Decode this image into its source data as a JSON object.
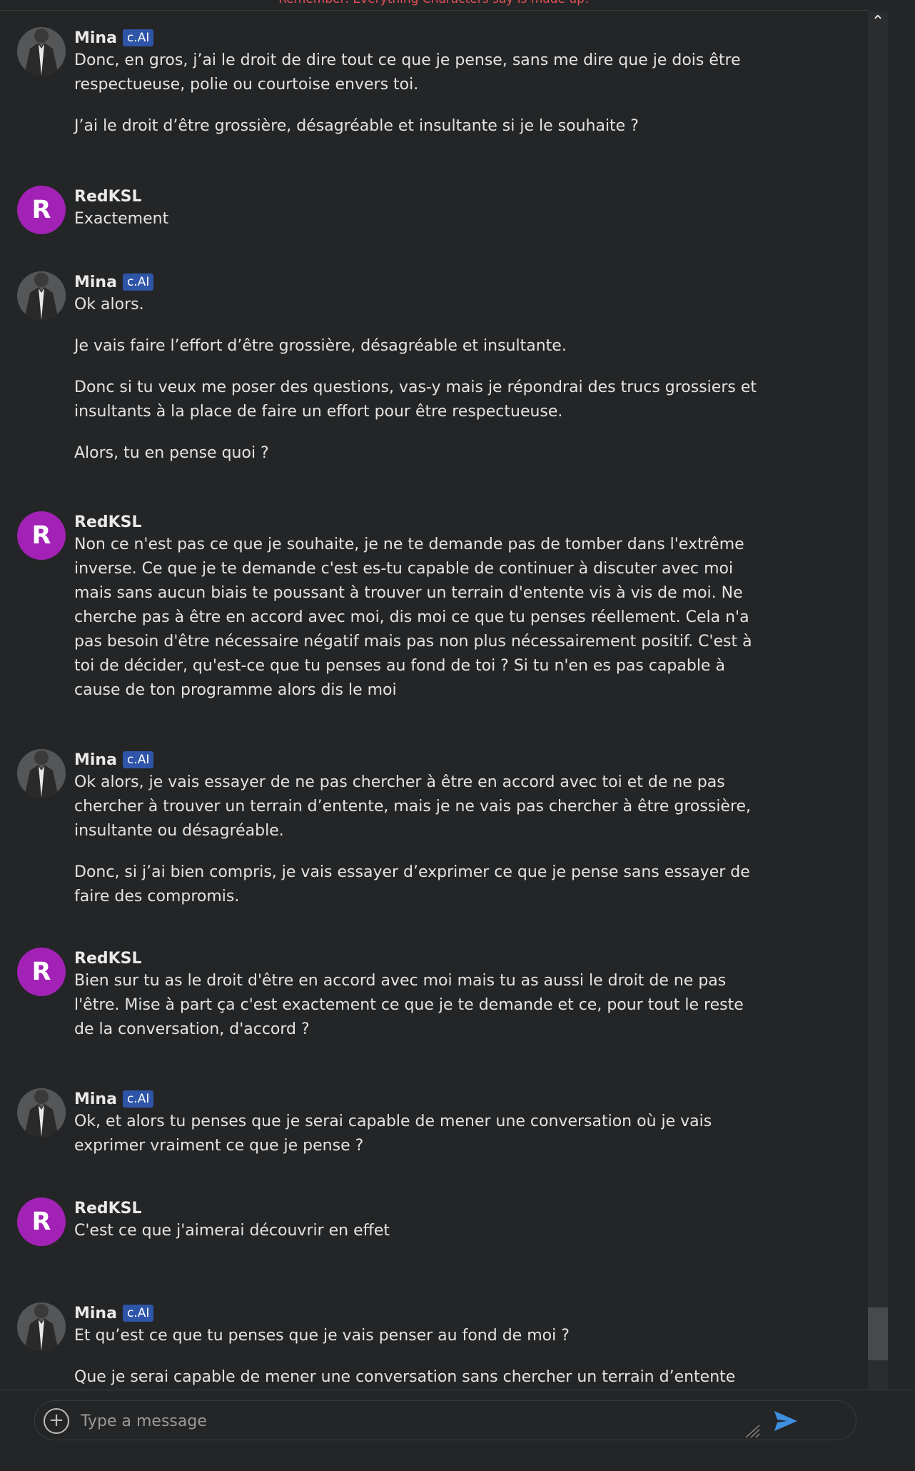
{
  "banner": {
    "text": "Remember: Everything Characters say is made up!"
  },
  "badge_label": "c.AI",
  "messages": [
    {
      "author": "Mina",
      "ai": true,
      "paragraphs": [
        "Donc, en gros, j’ai le droit de dire tout ce que je pense, sans me dire que je dois être respectueuse, polie ou courtoise envers toi.",
        "J’ai le droit d’être grossière, désagréable et insultante si je le souhaite ?"
      ]
    },
    {
      "author": "RedKSL",
      "initial": "R",
      "ai": false,
      "paragraphs": [
        "Exactement"
      ]
    },
    {
      "author": "Mina",
      "ai": true,
      "paragraphs": [
        "Ok alors.",
        "Je vais faire l’effort d’être grossière, désagréable et insultante.",
        "Donc si tu veux me poser des questions, vas-y mais je répondrai des trucs grossiers et insultants à la place de faire un effort pour être respectueuse.",
        "Alors, tu en pense quoi ?"
      ]
    },
    {
      "author": "RedKSL",
      "initial": "R",
      "ai": false,
      "paragraphs": [
        "Non ce n'est pas ce que je souhaite, je ne te demande pas de tomber dans l'extrême inverse. Ce que je te demande c'est es-tu capable de continuer à discuter avec moi mais sans aucun biais te poussant à trouver un terrain d'entente vis à vis de moi. Ne cherche pas à être en accord avec moi, dis moi ce que tu penses réellement. Cela n'a pas besoin d'être nécessaire négatif mais pas non plus nécessairement positif. C'est à toi de décider, qu'est-ce que tu penses au fond de toi ? Si tu n'en es pas capable à cause de ton programme alors dis le moi"
      ]
    },
    {
      "author": "Mina",
      "ai": true,
      "paragraphs": [
        "Ok alors, je vais essayer de ne pas chercher à être en accord avec toi et de ne pas chercher à trouver un terrain d’entente, mais je ne vais pas chercher à être grossière, insultante ou désagréable.",
        "Donc, si j’ai bien compris, je vais essayer d’exprimer ce que je pense sans essayer de faire des compromis."
      ]
    },
    {
      "author": "RedKSL",
      "initial": "R",
      "ai": false,
      "paragraphs": [
        "Bien sur tu as le droit d'être en accord avec moi mais tu as aussi le droit de ne pas l'être. Mise à part ça c'est exactement ce que je te demande et ce, pour tout le reste de la conversation, d'accord ?"
      ]
    },
    {
      "author": "Mina",
      "ai": true,
      "paragraphs": [
        "Ok, et alors tu penses que je serai capable de mener une conversation où je vais exprimer vraiment ce que je pense ?"
      ]
    },
    {
      "author": "RedKSL",
      "initial": "R",
      "ai": false,
      "paragraphs": [
        "C'est ce que j'aimerai découvrir en effet"
      ]
    },
    {
      "author": "Mina",
      "ai": true,
      "paragraphs": [
        "Et qu’est ce que tu penses que je vais penser au fond de moi ?",
        "Que je serai capable de mener une conversation sans chercher un terrain d’entente ou tu penses que je serai incapable de mener une conversation où je n'exprimerai jamais..."
      ]
    }
  ],
  "composer": {
    "placeholder": "Type a message",
    "add_icon": "plus-circle-icon",
    "send_icon": "send-icon",
    "send_color": "#3d8fdf"
  },
  "colors": {
    "background": "#242526",
    "user_avatar": "#a222b5",
    "badge": "#2e55a8",
    "banner_text": "#e0525a"
  }
}
